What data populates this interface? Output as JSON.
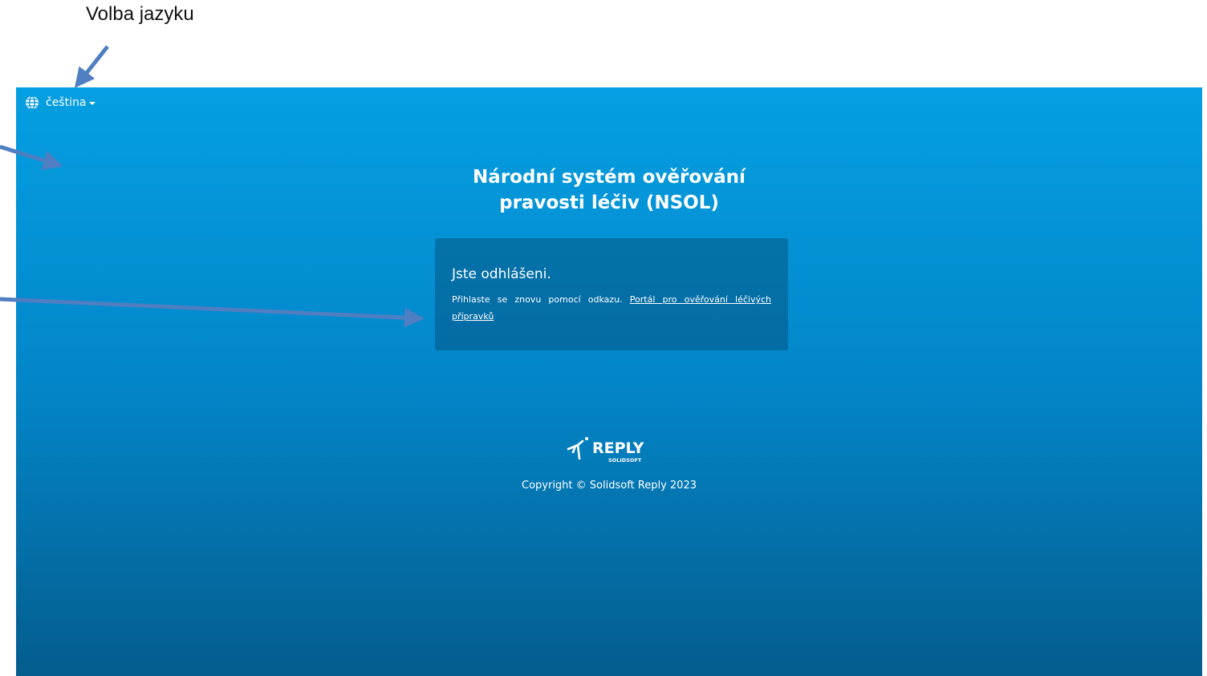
{
  "annotation": {
    "label": "Volba jazyku"
  },
  "header": {
    "language": "čeština"
  },
  "main": {
    "title_line1": "Národní systém ověřování",
    "title_line2": "pravosti léčiv (NSOL)",
    "panel": {
      "title": "Jste odhlášeni.",
      "text": "Přihlaste se znovu pomocí odkazu. ",
      "link": "Portál pro ověřování léčivých přípravků"
    }
  },
  "footer": {
    "logo_text": "REPLY",
    "logo_subtext": "SOLIDSOFT",
    "copyright": "Copyright © Solidsoft Reply 2023"
  },
  "colors": {
    "gradient_top": "#049fe2",
    "gradient_bottom": "#045d8e",
    "arrow": "#4f7ec2"
  },
  "icons": {
    "language": "globe-icon",
    "dropdown": "caret-down-icon",
    "logo": "reply-runner-icon"
  }
}
